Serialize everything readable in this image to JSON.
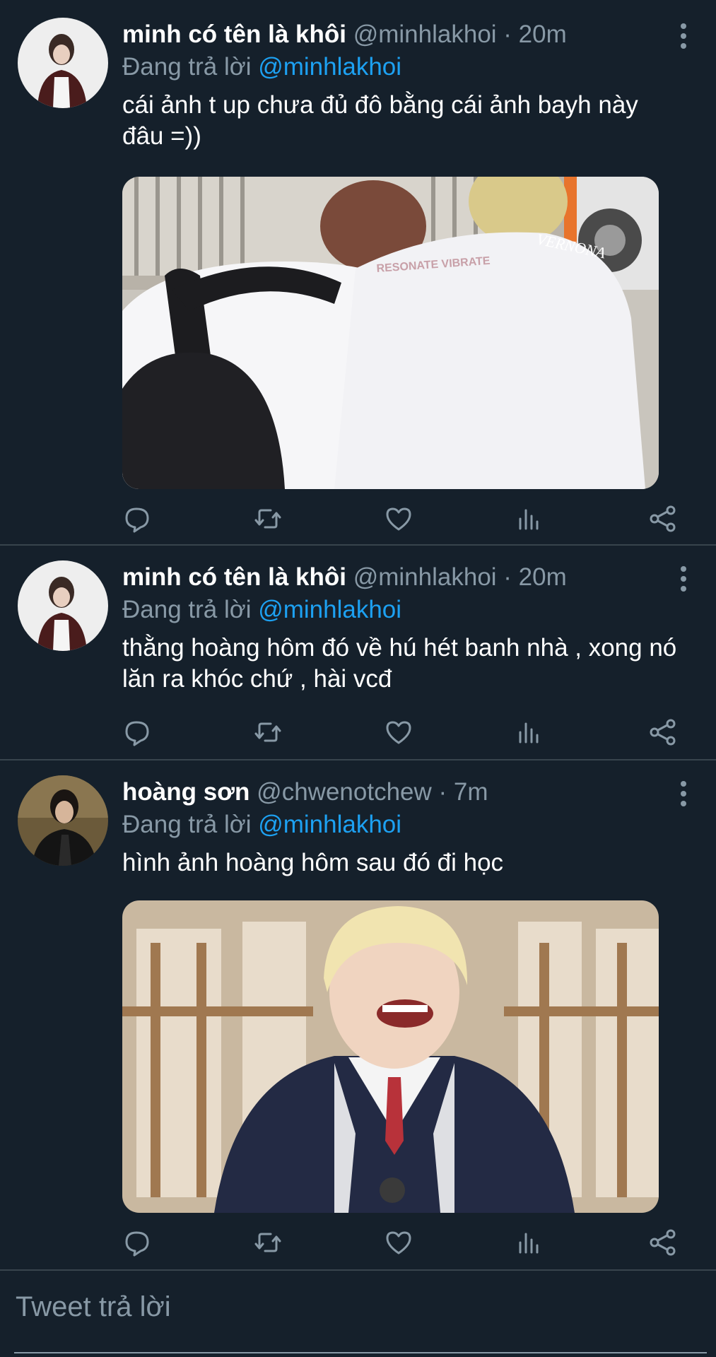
{
  "tweets": [
    {
      "name": "minh có tên là khôi",
      "handle": "@minhlakhoi",
      "time": "20m",
      "reply_prefix": "Đang trả lời",
      "reply_to": "@minhlakhoi",
      "text": "cái ảnh t up chưa đủ đô bằng cái ảnh bayh này đâu =))",
      "media_watermark": "VERNONA",
      "media_shirt_text": "RESONATE VIBRATE"
    },
    {
      "name": "minh có tên là khôi",
      "handle": "@minhlakhoi",
      "time": "20m",
      "reply_prefix": "Đang trả lời",
      "reply_to": "@minhlakhoi",
      "text": "thằng hoàng hôm đó về hú hét banh nhà , xong nó lăn ra khóc chứ , hài vcđ"
    },
    {
      "name": "hoàng sơn",
      "handle": "@chwenotchew",
      "time": "7m",
      "reply_prefix": "Đang trả lời",
      "reply_to": "@minhlakhoi",
      "text": "hình ảnh hoàng hôm sau đó đi học"
    }
  ],
  "separator": " · ",
  "composer": {
    "placeholder": "Tweet trả lời"
  },
  "icons": [
    "reply-icon",
    "retweet-icon",
    "like-icon",
    "analytics-icon",
    "share-icon",
    "more-options-icon"
  ],
  "colors": {
    "background": "#15202b",
    "secondary_text": "#8899a6",
    "link": "#1da1f2",
    "divider": "#38444d"
  }
}
